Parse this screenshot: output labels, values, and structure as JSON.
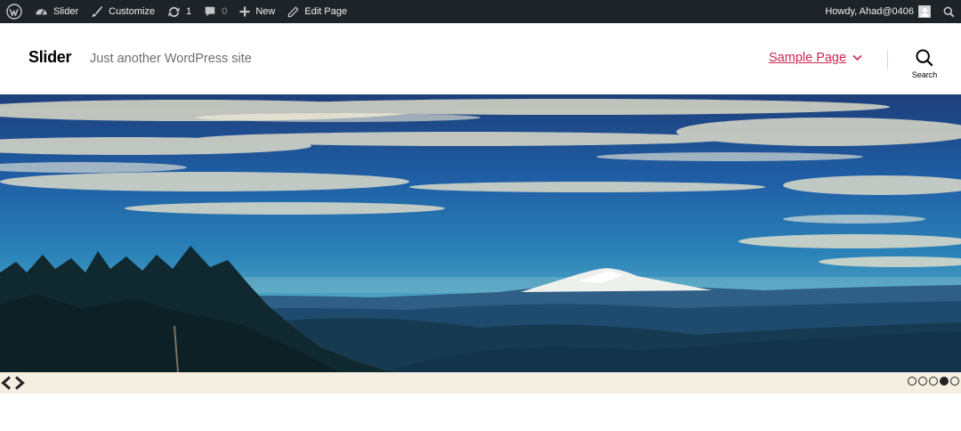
{
  "admin_bar": {
    "site_name": "Slider",
    "customize": "Customize",
    "updates_count": "1",
    "comments_count": "0",
    "new_label": "New",
    "edit_page": "Edit Page",
    "howdy": "Howdy, Ahad@0406"
  },
  "header": {
    "site_title": "Slider",
    "tagline": "Just another WordPress site",
    "nav": [
      {
        "label": "Sample Page"
      }
    ],
    "search_label": "Search"
  },
  "slider": {
    "slide_count": 5,
    "active_index": 3
  },
  "colors": {
    "admin_bar_bg": "#1d2327",
    "nav_accent": "#cd2653",
    "slider_controls_bg": "#f4efe1"
  }
}
